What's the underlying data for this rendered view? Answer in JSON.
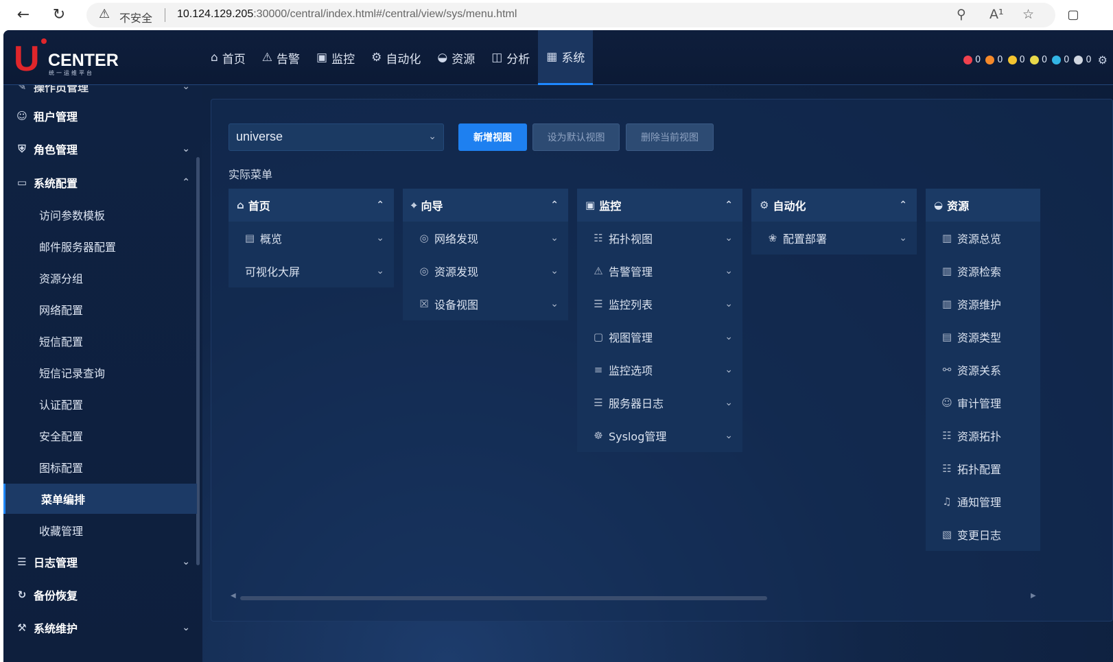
{
  "browser": {
    "insecure_label": "不安全",
    "url_host": "10.124.129.205",
    "url_rest": ":30000/central/index.html#/central/view/sys/menu.html"
  },
  "logo": {
    "brand": "CENTER",
    "sub": "统一运维平台"
  },
  "main_nav": [
    {
      "label": "首页",
      "icon": "home-icon"
    },
    {
      "label": "告警",
      "icon": "warning-icon"
    },
    {
      "label": "监控",
      "icon": "monitor-icon"
    },
    {
      "label": "自动化",
      "icon": "automation-icon"
    },
    {
      "label": "资源",
      "icon": "resource-icon"
    },
    {
      "label": "分析",
      "icon": "chart-icon"
    },
    {
      "label": "系统",
      "icon": "system-icon",
      "active": true
    }
  ],
  "alarm_counts": [
    {
      "color": "#f0414e",
      "count": "0"
    },
    {
      "color": "#f5892a",
      "count": "0"
    },
    {
      "color": "#f4c430",
      "count": "0"
    },
    {
      "color": "#e8d84a",
      "count": "0"
    },
    {
      "color": "#33b5e5",
      "count": "0"
    },
    {
      "color": "#d0d6e0",
      "count": "0"
    }
  ],
  "sidebar": {
    "top_partial": "操作员管理",
    "items": [
      {
        "label": "租户管理",
        "type": "top",
        "icon": "user-icon"
      },
      {
        "label": "角色管理",
        "type": "top",
        "icon": "shield-icon",
        "chev": "down"
      },
      {
        "label": "系统配置",
        "type": "top",
        "icon": "config-icon",
        "chev": "up"
      },
      {
        "label": "访问参数模板",
        "type": "sub"
      },
      {
        "label": "邮件服务器配置",
        "type": "sub"
      },
      {
        "label": "资源分组",
        "type": "sub"
      },
      {
        "label": "网络配置",
        "type": "sub"
      },
      {
        "label": "短信配置",
        "type": "sub"
      },
      {
        "label": "短信记录查询",
        "type": "sub"
      },
      {
        "label": "认证配置",
        "type": "sub"
      },
      {
        "label": "安全配置",
        "type": "sub"
      },
      {
        "label": "图标配置",
        "type": "sub"
      },
      {
        "label": "菜单编排",
        "type": "sub",
        "active": true
      },
      {
        "label": "收藏管理",
        "type": "sub"
      },
      {
        "label": "日志管理",
        "type": "top",
        "icon": "log-icon",
        "chev": "down"
      },
      {
        "label": "备份恢复",
        "type": "top",
        "icon": "backup-icon"
      },
      {
        "label": "系统维护",
        "type": "top",
        "icon": "maintain-icon",
        "chev": "down"
      }
    ]
  },
  "content": {
    "view_select": "universe",
    "buttons": {
      "add": "新增视图",
      "set_default": "设为默认视图",
      "delete": "删除当前视图"
    },
    "section_label": "实际菜单",
    "columns": [
      {
        "title": "首页",
        "icon": "home-icon",
        "items": [
          {
            "label": "概览",
            "icon": "overview-icon"
          },
          {
            "label": "可视化大屏",
            "icon": ""
          }
        ]
      },
      {
        "title": "向导",
        "icon": "guide-icon",
        "items": [
          {
            "label": "网络发现",
            "icon": "discover-icon"
          },
          {
            "label": "资源发现",
            "icon": "discover-icon"
          },
          {
            "label": "设备视图",
            "icon": "device-icon"
          }
        ]
      },
      {
        "title": "监控",
        "icon": "monitor-icon",
        "items": [
          {
            "label": "拓扑视图",
            "icon": "topology-icon"
          },
          {
            "label": "告警管理",
            "icon": "warning-icon"
          },
          {
            "label": "监控列表",
            "icon": "list-icon"
          },
          {
            "label": "视图管理",
            "icon": "view-icon"
          },
          {
            "label": "监控选项",
            "icon": "options-icon"
          },
          {
            "label": "服务器日志",
            "icon": "log-icon"
          },
          {
            "label": "Syslog管理",
            "icon": "syslog-icon"
          }
        ]
      },
      {
        "title": "自动化",
        "icon": "automation-icon",
        "items": [
          {
            "label": "配置部署",
            "icon": "deploy-icon"
          }
        ]
      },
      {
        "title": "资源",
        "icon": "resource-icon",
        "items": [
          {
            "label": "资源总览",
            "icon": "resource-item-icon"
          },
          {
            "label": "资源检索",
            "icon": "resource-item-icon"
          },
          {
            "label": "资源维护",
            "icon": "resource-item-icon"
          },
          {
            "label": "资源类型",
            "icon": "doc-icon"
          },
          {
            "label": "资源关系",
            "icon": "relation-icon"
          },
          {
            "label": "审计管理",
            "icon": "audit-icon"
          },
          {
            "label": "资源拓扑",
            "icon": "topology-icon"
          },
          {
            "label": "拓扑配置",
            "icon": "topology-icon"
          },
          {
            "label": "通知管理",
            "icon": "notify-icon"
          },
          {
            "label": "变更日志",
            "icon": "changelog-icon"
          }
        ]
      }
    ]
  }
}
